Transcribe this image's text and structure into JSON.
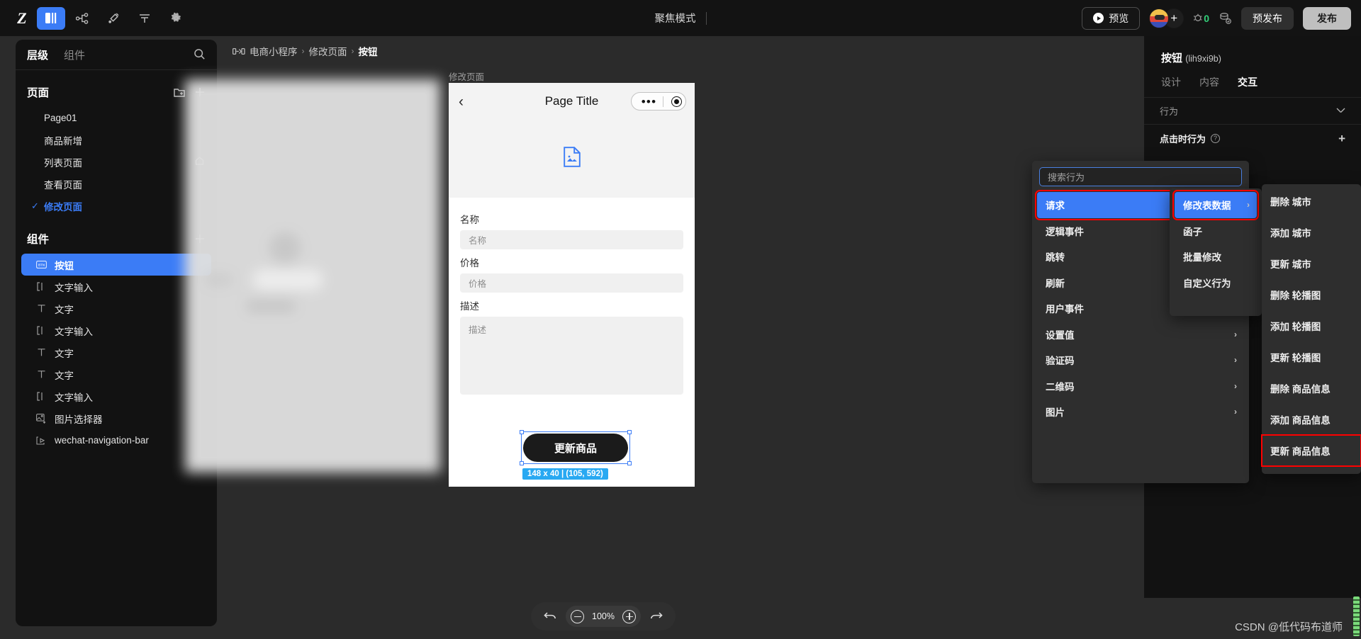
{
  "topbar": {
    "logo": "Z",
    "icons": [
      {
        "name": "layers-icon",
        "active": true
      },
      {
        "name": "flow-icon",
        "active": false
      },
      {
        "name": "plugin-icon",
        "active": false
      },
      {
        "name": "database-icon",
        "active": false
      },
      {
        "name": "gear-icon",
        "active": false
      }
    ],
    "focus_mode": "聚焦模式",
    "preview_label": "预览",
    "bug_count": "0",
    "pre_publish_label": "预发布",
    "publish_label": "发布"
  },
  "sidebar": {
    "tabs": [
      {
        "label": "层级",
        "active": true
      },
      {
        "label": "组件",
        "active": false
      }
    ],
    "pages_section": {
      "title": "页面",
      "items": [
        {
          "label": "Page01",
          "selected": false,
          "home": false
        },
        {
          "label": "商品新增",
          "selected": false,
          "home": false
        },
        {
          "label": "列表页面",
          "selected": false,
          "home": true
        },
        {
          "label": "查看页面",
          "selected": false,
          "home": false
        },
        {
          "label": "修改页面",
          "selected": true,
          "home": false
        }
      ]
    },
    "components_section": {
      "title": "组件",
      "items": [
        {
          "label": "按钮",
          "icon": "button-icon",
          "selected": true
        },
        {
          "label": "文字输入",
          "icon": "text-input-icon",
          "selected": false
        },
        {
          "label": "文字",
          "icon": "text-icon",
          "selected": false
        },
        {
          "label": "文字输入",
          "icon": "text-input-icon",
          "selected": false
        },
        {
          "label": "文字",
          "icon": "text-icon",
          "selected": false
        },
        {
          "label": "文字",
          "icon": "text-icon",
          "selected": false
        },
        {
          "label": "文字输入",
          "icon": "text-input-icon",
          "selected": false
        },
        {
          "label": "图片选择器",
          "icon": "image-picker-icon",
          "selected": false
        },
        {
          "label": "wechat-navigation-bar",
          "icon": "nav-bar-icon",
          "selected": false
        }
      ]
    }
  },
  "breadcrumb": {
    "root": "电商小程序",
    "page": "修改页面",
    "component": "按钮",
    "separator": "›"
  },
  "canvas": {
    "page_label": "修改页面",
    "phone": {
      "nav_title": "Page Title",
      "fields": [
        {
          "label": "名称",
          "placeholder": "名称",
          "type": "input"
        },
        {
          "label": "价格",
          "placeholder": "价格",
          "type": "input"
        },
        {
          "label": "描述",
          "placeholder": "描述",
          "type": "textarea"
        }
      ],
      "submit_label": "更新商品"
    },
    "selection_badge": "148 x 40 | (105, 592)",
    "zoom_level": "100%"
  },
  "right_panel": {
    "component_name": "按钮",
    "component_id": "(lih9xi9b)",
    "tabs": [
      {
        "label": "设计",
        "active": false
      },
      {
        "label": "内容",
        "active": false
      },
      {
        "label": "交互",
        "active": true
      }
    ],
    "section_label": "行为",
    "row_label": "点击时行为"
  },
  "flyout": {
    "search_placeholder": "搜索行为",
    "column1": [
      {
        "label": "请求",
        "selected": true,
        "highlight": true,
        "arrow": "›"
      },
      {
        "label": "逻辑事件",
        "selected": false,
        "highlight": false,
        "arrow": "›"
      },
      {
        "label": "跳转",
        "selected": false,
        "highlight": false,
        "arrow": "›"
      },
      {
        "label": "刷新",
        "selected": false,
        "highlight": false,
        "arrow": "›"
      },
      {
        "label": "用户事件",
        "selected": false,
        "highlight": false,
        "arrow": "›"
      },
      {
        "label": "设置值",
        "selected": false,
        "highlight": false,
        "arrow": "›"
      },
      {
        "label": "验证码",
        "selected": false,
        "highlight": false,
        "arrow": "›"
      },
      {
        "label": "二维码",
        "selected": false,
        "highlight": false,
        "arrow": "›"
      },
      {
        "label": "图片",
        "selected": false,
        "highlight": false,
        "arrow": "›"
      }
    ],
    "column2": [
      {
        "label": "修改表数据",
        "selected": true,
        "highlight": true,
        "arrow": "›"
      },
      {
        "label": "函子",
        "selected": false,
        "highlight": false,
        "arrow": ""
      },
      {
        "label": "批量修改",
        "selected": false,
        "highlight": false,
        "arrow": ""
      },
      {
        "label": "自定义行为",
        "selected": false,
        "highlight": false,
        "arrow": ""
      }
    ],
    "column3": [
      {
        "label": "删除 城市",
        "highlight": false
      },
      {
        "label": "添加 城市",
        "highlight": false
      },
      {
        "label": "更新 城市",
        "highlight": false
      },
      {
        "label": "删除 轮播图",
        "highlight": false
      },
      {
        "label": "添加 轮播图",
        "highlight": false
      },
      {
        "label": "更新 轮播图",
        "highlight": false
      },
      {
        "label": "删除 商品信息",
        "highlight": false
      },
      {
        "label": "添加 商品信息",
        "highlight": false
      },
      {
        "label": "更新 商品信息",
        "highlight": true
      }
    ]
  },
  "watermark": "CSDN @低代码布道师",
  "colors": {
    "accent_blue": "#3b7cf6",
    "badge_blue": "#29a9f2",
    "highlight_red": "#ff0000",
    "panel_dark": "#121212",
    "canvas_dark": "#2b2b2b",
    "menu_dark": "#2e2e2e"
  }
}
